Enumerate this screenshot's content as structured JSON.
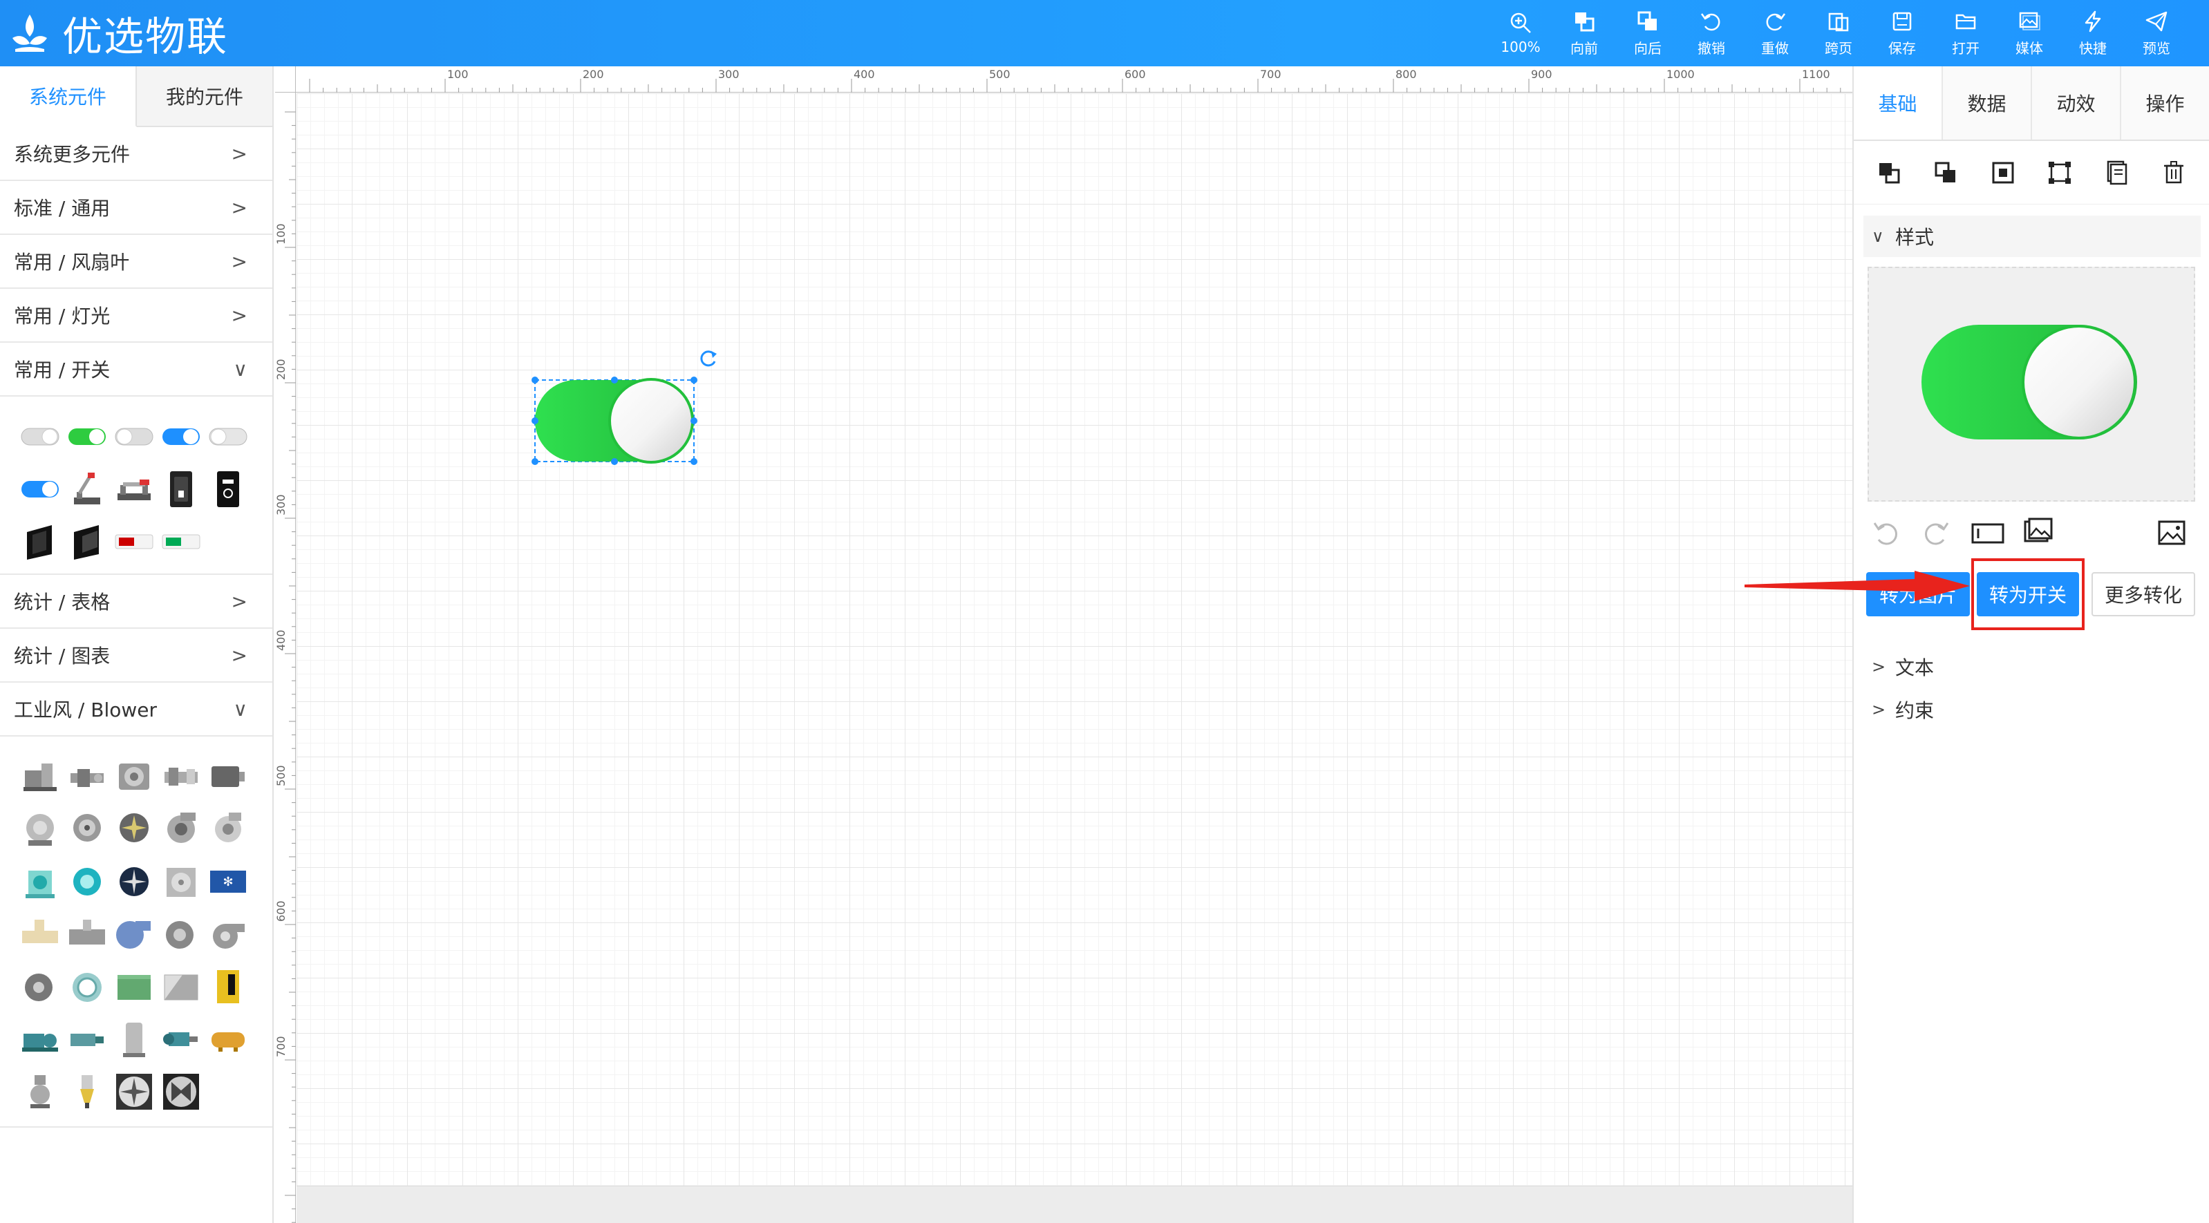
{
  "app": {
    "title": "优选物联"
  },
  "toolbar": {
    "items": [
      {
        "icon": "zoom-in-icon",
        "label": "100%"
      },
      {
        "icon": "bring-forward-icon",
        "label": "向前"
      },
      {
        "icon": "send-backward-icon",
        "label": "向后"
      },
      {
        "icon": "undo-icon",
        "label": "撤销"
      },
      {
        "icon": "redo-icon",
        "label": "重做"
      },
      {
        "icon": "cross-page-icon",
        "label": "跨页"
      },
      {
        "icon": "save-icon",
        "label": "保存"
      },
      {
        "icon": "open-folder-icon",
        "label": "打开"
      },
      {
        "icon": "media-icon",
        "label": "媒体"
      },
      {
        "icon": "lightning-icon",
        "label": "快捷"
      },
      {
        "icon": "send-icon",
        "label": "预览"
      }
    ]
  },
  "left": {
    "tabs": [
      "系统元件",
      "我的元件"
    ],
    "categories": [
      {
        "label": "系统更多元件",
        "arrow": ">"
      },
      {
        "label": "标准 / 通用",
        "arrow": ">"
      },
      {
        "label": "常用 / 风扇叶",
        "arrow": ">"
      },
      {
        "label": "常用 / 灯光",
        "arrow": ">"
      },
      {
        "label": "常用 / 开关",
        "arrow": "∨"
      },
      {
        "label": "统计 / 表格",
        "arrow": ">"
      },
      {
        "label": "统计 / 图表",
        "arrow": ">"
      },
      {
        "label": "工业风 / Blower",
        "arrow": "∨"
      }
    ],
    "switch_icons": [
      "toggle-gray-off-icon",
      "toggle-green-on-icon",
      "toggle-gray-off-icon",
      "toggle-blue-on-icon",
      "toggle-gray-off-icon",
      "toggle-blue-on-icon",
      "knife-switch-icon",
      "knife-switch-red-icon",
      "rocker-switch-dark-icon",
      "rocker-switch-black-icon",
      "panel-switch-black-icon",
      "panel-switch-open-icon",
      "button-off-red-icon",
      "button-on-green-icon"
    ],
    "blower_icons_count_note": ""
  },
  "right": {
    "tabs": [
      "基础",
      "数据",
      "动效",
      "操作"
    ],
    "tools": [
      "bring-to-front-icon",
      "send-to-back-icon",
      "fit-icon",
      "align-icon",
      "copy-icon",
      "trash-icon"
    ],
    "style_section": "样式",
    "buttons": {
      "to_image": "转为图片",
      "to_switch": "转为开关",
      "more": "更多转化"
    },
    "sections": [
      "文本",
      "约束"
    ]
  },
  "ruler": {
    "top_labels": [
      "100",
      "200",
      "300",
      "400",
      "500",
      "600",
      "700",
      "800",
      "900",
      "1000",
      "1100"
    ],
    "left_labels": [
      "100",
      "200",
      "300",
      "400",
      "500",
      "600",
      "700"
    ]
  },
  "colors": {
    "brand": "#1e90ff",
    "switch_green": "#2ecc40",
    "highlight": "#e8231d"
  }
}
